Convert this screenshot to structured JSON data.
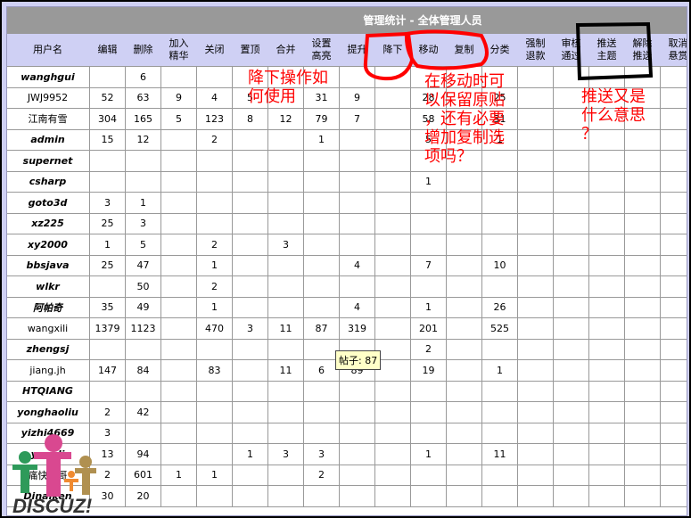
{
  "title": "管理统计 - 全体管理人员",
  "columns": [
    "用户名",
    "编辑",
    "删除",
    "加入\n精华",
    "关闭",
    "置顶",
    "合并",
    "设置\n高亮",
    "提升",
    "降下",
    "移动",
    "复制",
    "分类",
    "强制\n退款",
    "审核\n通过",
    "推送\n主题",
    "解除\n推送",
    "取消\n悬赏"
  ],
  "rows": [
    {
      "name": "wanghgui",
      "bold": true,
      "v": [
        "",
        "6",
        "",
        "",
        "",
        "",
        "",
        "",
        "",
        "",
        "",
        "",
        "",
        "",
        "",
        "",
        ""
      ]
    },
    {
      "name": "JWJ9952",
      "bold": false,
      "v": [
        "52",
        "63",
        "9",
        "4",
        "5",
        "",
        "31",
        "9",
        "",
        "28",
        "",
        "25",
        "",
        "",
        "",
        "",
        ""
      ]
    },
    {
      "name": "江南有雪",
      "bold": false,
      "v": [
        "304",
        "165",
        "5",
        "123",
        "8",
        "12",
        "79",
        "7",
        "",
        "58",
        "",
        "31",
        "",
        "",
        "",
        "",
        ""
      ]
    },
    {
      "name": "admin",
      "bold": true,
      "v": [
        "15",
        "12",
        "",
        "2",
        "",
        "",
        "1",
        "",
        "",
        "5",
        "",
        "1",
        "",
        "",
        "",
        "",
        ""
      ]
    },
    {
      "name": "supernet",
      "bold": true,
      "v": [
        "",
        "",
        "",
        "",
        "",
        "",
        "",
        "",
        "",
        "",
        "",
        "",
        "",
        "",
        "",
        "",
        ""
      ]
    },
    {
      "name": "csharp",
      "bold": true,
      "v": [
        "",
        "",
        "",
        "",
        "",
        "",
        "",
        "",
        "",
        "1",
        "",
        "",
        "",
        "",
        "",
        "",
        ""
      ]
    },
    {
      "name": "goto3d",
      "bold": true,
      "v": [
        "3",
        "1",
        "",
        "",
        "",
        "",
        "",
        "",
        "",
        "",
        "",
        "",
        "",
        "",
        "",
        "",
        ""
      ]
    },
    {
      "name": "xz225",
      "bold": true,
      "v": [
        "25",
        "3",
        "",
        "",
        "",
        "",
        "",
        "",
        "",
        "",
        "",
        "",
        "",
        "",
        "",
        "",
        ""
      ]
    },
    {
      "name": "xy2000",
      "bold": true,
      "v": [
        "1",
        "5",
        "",
        "2",
        "",
        "3",
        "",
        "",
        "",
        "",
        "",
        "",
        "",
        "",
        "",
        "",
        ""
      ]
    },
    {
      "name": "bbsjava",
      "bold": true,
      "v": [
        "25",
        "47",
        "",
        "1",
        "",
        "",
        "",
        "4",
        "",
        "7",
        "",
        "10",
        "",
        "",
        "",
        "",
        ""
      ]
    },
    {
      "name": "wlkr",
      "bold": true,
      "v": [
        "",
        "50",
        "",
        "2",
        "",
        "",
        "",
        "",
        "",
        "",
        "",
        "",
        "",
        "",
        "",
        "",
        ""
      ]
    },
    {
      "name": "阿帕奇",
      "bold": true,
      "v": [
        "35",
        "49",
        "",
        "1",
        "",
        "",
        "",
        "4",
        "",
        "1",
        "",
        "26",
        "",
        "",
        "",
        "",
        ""
      ]
    },
    {
      "name": "wangxili",
      "bold": false,
      "v": [
        "1379",
        "1123",
        "",
        "470",
        "3",
        "11",
        "87",
        "319",
        "",
        "201",
        "",
        "525",
        "",
        "",
        "",
        "",
        ""
      ]
    },
    {
      "name": "zhengsj",
      "bold": true,
      "v": [
        "",
        "",
        "",
        "",
        "",
        "",
        "",
        "",
        "",
        "2",
        "",
        "",
        "",
        "",
        "",
        "",
        ""
      ]
    },
    {
      "name": "jiang.jh",
      "bold": false,
      "v": [
        "147",
        "84",
        "",
        "83",
        "",
        "11",
        "6",
        "89",
        "",
        "19",
        "",
        "1",
        "",
        "",
        "",
        "",
        ""
      ]
    },
    {
      "name": "HTQIANG",
      "bold": true,
      "v": [
        "",
        "",
        "",
        "",
        "",
        "",
        "",
        "",
        "",
        "",
        "",
        "",
        "",
        "",
        "",
        "",
        ""
      ]
    },
    {
      "name": "yonghaoliu",
      "bold": true,
      "v": [
        "2",
        "42",
        "",
        "",
        "",
        "",
        "",
        "",
        "",
        "",
        "",
        "",
        "",
        "",
        "",
        "",
        ""
      ]
    },
    {
      "name": "yizhi4669",
      "bold": true,
      "v": [
        "3",
        "",
        "",
        "",
        "",
        "",
        "",
        "",
        "",
        "",
        "",
        "",
        "",
        "",
        "",
        "",
        ""
      ]
    },
    {
      "name": "yenuli",
      "bold": true,
      "v": [
        "13",
        "94",
        "",
        "",
        "1",
        "3",
        "3",
        "",
        "",
        "1",
        "",
        "11",
        "",
        "",
        "",
        "",
        ""
      ]
    },
    {
      "name": "痛快大哥",
      "bold": false,
      "v": [
        "2",
        "601",
        "1",
        "1",
        "",
        "",
        "2",
        "",
        "",
        "",
        "",
        "",
        "",
        "",
        "",
        "",
        ""
      ]
    },
    {
      "name": "Dinaiken",
      "bold": true,
      "v": [
        "30",
        "20",
        "",
        "",
        "",
        "",
        "",
        "",
        "",
        "",
        "",
        "",
        "",
        "",
        "",
        "",
        ""
      ]
    }
  ],
  "tooltip": "帖子: 87",
  "annotations": {
    "a1": "降下操作如\n何使用",
    "a2": "在移动时可\n以保留原贴\n，还有必要\n增加复制选\n项吗？",
    "a3": "推送又是\n什么意思\n？"
  },
  "logo": "DISCUZ!",
  "colors": {
    "header_bg": "#cfd0f4",
    "title_bg": "#999999",
    "annotation": "#ff0000"
  }
}
